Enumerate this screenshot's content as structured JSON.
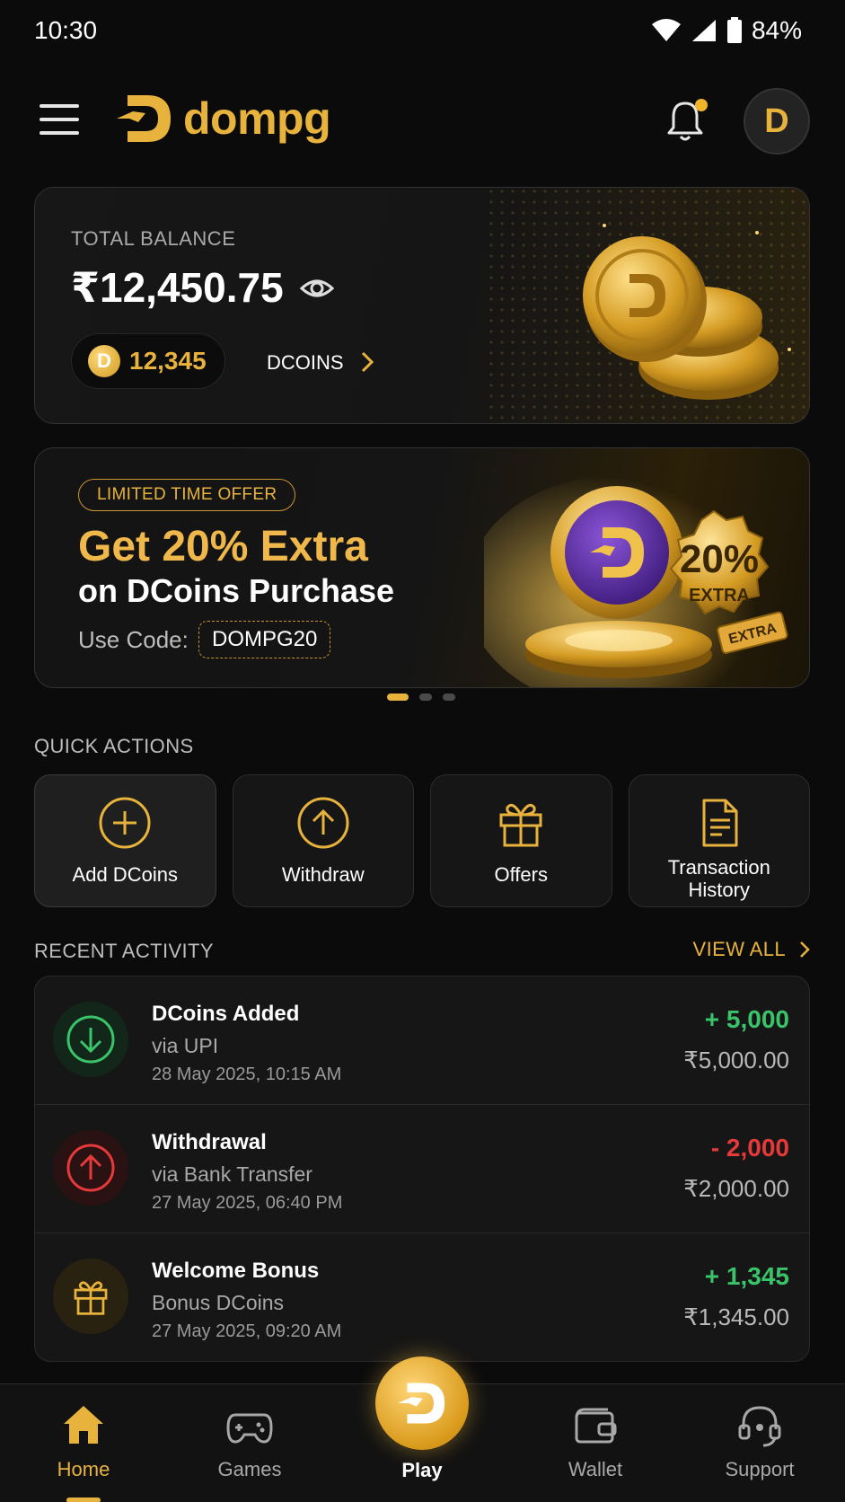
{
  "status_bar": {
    "time": "10:30",
    "battery": "84%",
    "icons": [
      "wifi-icon",
      "signal-icon",
      "battery-icon"
    ]
  },
  "header": {
    "brand": "dompg",
    "avatar_initial": "D",
    "has_notification": true
  },
  "balance": {
    "label": "TOTAL BALANCE",
    "amount": "₹12,450.75",
    "dcoins_value": "12,345",
    "dcoins_unit": "DCOINS",
    "coin_glyph": "D"
  },
  "offer": {
    "tag": "LIMITED TIME OFFER",
    "title": "Get 20% Extra",
    "subtitle": "on DCoins Purchase",
    "code_label": "Use Code:",
    "code": "DOMPG20",
    "badge_percent": "20%",
    "badge_extra": "EXTRA",
    "badge_ribbon": "EXTRA",
    "carousel_pages": 3,
    "carousel_active": 1
  },
  "quick_actions": {
    "title": "QUICK ACTIONS",
    "items": [
      {
        "label": "Add DCoins",
        "icon": "plus-circle-icon"
      },
      {
        "label": "Withdraw",
        "icon": "arrow-up-circle-icon"
      },
      {
        "label": "Offers",
        "icon": "gift-icon"
      },
      {
        "label": "Transaction History",
        "icon": "document-icon"
      }
    ]
  },
  "recent_activity": {
    "title": "RECENT ACTIVITY",
    "view_all": "VIEW ALL",
    "items": [
      {
        "name": "DCoins Added",
        "method": "via UPI",
        "date": "28 May 2025, 10:15 AM",
        "coins": "+ 5,000",
        "amount": "₹5,000.00",
        "type": "credit"
      },
      {
        "name": "Withdrawal",
        "method": "via Bank Transfer",
        "date": "27 May 2025, 06:40 PM",
        "coins": "- 2,000",
        "amount": "₹2,000.00",
        "type": "debit"
      },
      {
        "name": "Welcome Bonus",
        "method": "Bonus DCoins",
        "date": "27 May 2025, 09:20 AM",
        "coins": "+ 1,345",
        "amount": "₹1,345.00",
        "type": "bonus"
      }
    ]
  },
  "bottom_nav": {
    "home": "Home",
    "games": "Games",
    "play": "Play",
    "wallet": "Wallet",
    "support": "Support",
    "active": "home"
  },
  "colors": {
    "accent": "#e8b33c",
    "background": "#0b0b0c",
    "positive": "#39c46a",
    "negative": "#e5393a",
    "offer_coin": "#5a2fa0"
  }
}
